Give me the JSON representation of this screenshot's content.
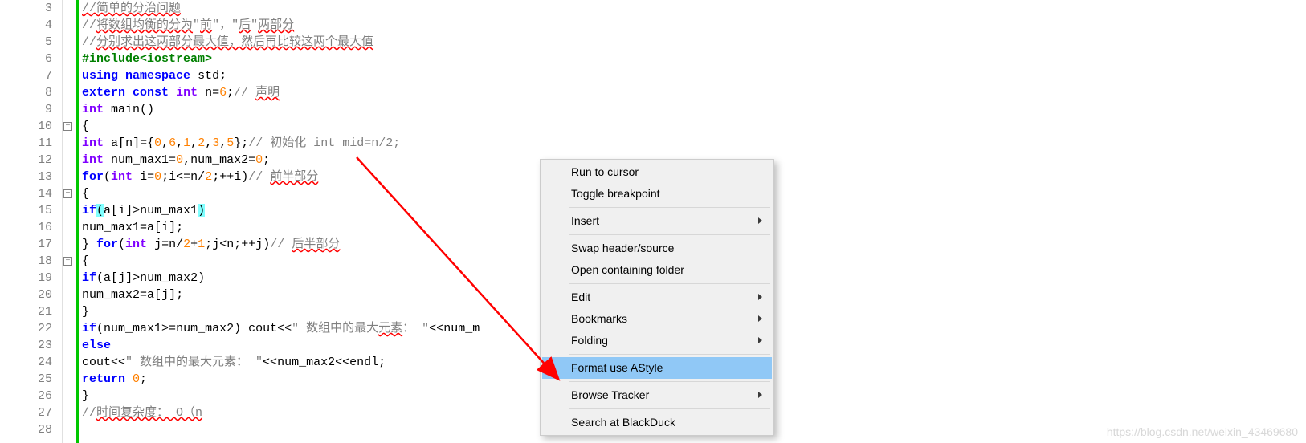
{
  "gutter_start": 3,
  "gutter_end": 28,
  "code_lines": [
    {
      "html": "<span class='c-comment squiggle'>//简单的分治问题</span>"
    },
    {
      "html": "<span class='c-comment'>//<span class='squiggle'>将数组均衡的分为</span>\"<span class='squiggle'>前</span>\"，\"<span class='squiggle'>后</span>\"<span class='squiggle'>两部分</span></span>"
    },
    {
      "html": "<span class='c-comment'>//<span class='squiggle'>分别求出这两部分最大值，然后再比较这两个最大值</span></span>"
    },
    {
      "html": "<span class='c-preproc'>#include&lt;iostream&gt;</span>"
    },
    {
      "html": "<span class='c-keyword'>using</span> <span class='c-keyword'>namespace</span> <span class='c-id'>std</span>;"
    },
    {
      "html": "<span class='c-keyword'>extern</span> <span class='c-keyword'>const</span> <span class='c-type'>int</span> <span class='c-id'>n</span>=<span class='c-num'>6</span>;<span class='c-comment'>// <span class='squiggle'>声明</span></span>"
    },
    {
      "html": "<span class='c-type'>int</span> <span class='c-id'>main</span>()"
    },
    {
      "html": "{"
    },
    {
      "html": "<span class='c-type'>int</span> <span class='c-id'>a</span>[<span class='c-id'>n</span>]={<span class='c-num'>0</span>,<span class='c-num'>6</span>,<span class='c-num'>1</span>,<span class='c-num'>2</span>,<span class='c-num'>3</span>,<span class='c-num'>5</span>};<span class='c-comment'>// 初始化 int mid=n/2;</span>"
    },
    {
      "html": "<span class='c-type'>int</span> <span class='c-id'>num_max1</span>=<span class='c-num'>0</span>,<span class='c-id'>num_max2</span>=<span class='c-num'>0</span>;"
    },
    {
      "html": "<span class='c-keyword'>for</span>(<span class='c-type'>int</span> <span class='c-id'>i</span>=<span class='c-num'>0</span>;<span class='c-id'>i</span>&lt;=<span class='c-id'>n</span>/<span class='c-num'>2</span>;++<span class='c-id'>i</span>)<span class='c-comment'>// <span class='squiggle'>前半部分</span></span>"
    },
    {
      "html": "{"
    },
    {
      "html": "<span class='c-keyword'>if</span><span class='c-bracket-hl'>(</span><span class='c-id'>a</span>[<span class='c-id'>i</span>]&gt;<span class='c-id'>num_max1</span><span class='c-bracket-hl'>)</span>"
    },
    {
      "html": "<span class='c-id'>num_max1</span>=<span class='c-id'>a</span>[<span class='c-id'>i</span>];"
    },
    {
      "html": "} <span class='c-keyword'>for</span>(<span class='c-type'>int</span> <span class='c-id'>j</span>=<span class='c-id'>n</span>/<span class='c-num'>2</span>+<span class='c-num'>1</span>;<span class='c-id'>j</span>&lt;<span class='c-id'>n</span>;++<span class='c-id'>j</span>)<span class='c-comment'>// <span class='squiggle'>后半部分</span></span>"
    },
    {
      "html": "{"
    },
    {
      "html": "<span class='c-keyword'>if</span>(<span class='c-id'>a</span>[<span class='c-id'>j</span>]&gt;<span class='c-id'>num_max2</span>)"
    },
    {
      "html": "<span class='c-id'>num_max2</span>=<span class='c-id'>a</span>[<span class='c-id'>j</span>];"
    },
    {
      "html": "}"
    },
    {
      "html": "<span class='c-keyword'>if</span>(<span class='c-id'>num_max1</span>&gt;=<span class='c-id'>num_max2</span>) <span class='c-id'>cout</span>&lt;&lt;<span class='c-string'>\" 数组中的最大<span class='squiggle'>元素</span>： \"</span>&lt;&lt;<span class='c-id'>num_m</span>"
    },
    {
      "html": "<span class='c-keyword'>else</span>"
    },
    {
      "html": "<span class='c-id'>cout</span>&lt;&lt;<span class='c-string'>\" 数组中的最大元素： \"</span>&lt;&lt;<span class='c-id'>num_max2</span>&lt;&lt;<span class='c-id'>endl</span>;"
    },
    {
      "html": "<span class='c-keyword'>return</span> <span class='c-num'>0</span>;"
    },
    {
      "html": "}"
    },
    {
      "html": "<span class='c-comment'>//<span class='squiggle'>时间复杂度： O（n</span></span>"
    },
    {
      "html": ""
    }
  ],
  "fold_markers": [
    {
      "line": 10,
      "symbol": "−"
    },
    {
      "line": 14,
      "symbol": "−"
    },
    {
      "line": 18,
      "symbol": "−"
    }
  ],
  "menu": {
    "items": [
      {
        "label": "Run to cursor",
        "sub": false,
        "hl": false
      },
      {
        "label": "Toggle breakpoint",
        "sub": false,
        "hl": false
      },
      {
        "sep": true
      },
      {
        "label": "Insert",
        "sub": true,
        "hl": false
      },
      {
        "sep": true
      },
      {
        "label": "Swap header/source",
        "sub": false,
        "hl": false
      },
      {
        "label": "Open containing folder",
        "sub": false,
        "hl": false
      },
      {
        "sep": true
      },
      {
        "label": "Edit",
        "sub": true,
        "hl": false
      },
      {
        "label": "Bookmarks",
        "sub": true,
        "hl": false
      },
      {
        "label": "Folding",
        "sub": true,
        "hl": false
      },
      {
        "sep": true
      },
      {
        "label": "Format use AStyle",
        "sub": false,
        "hl": true
      },
      {
        "sep": true
      },
      {
        "label": "Browse Tracker",
        "sub": true,
        "hl": false
      },
      {
        "sep": true
      },
      {
        "label": "Search at BlackDuck",
        "sub": false,
        "hl": false
      }
    ]
  },
  "watermark": "https://blog.csdn.net/weixin_43469680"
}
